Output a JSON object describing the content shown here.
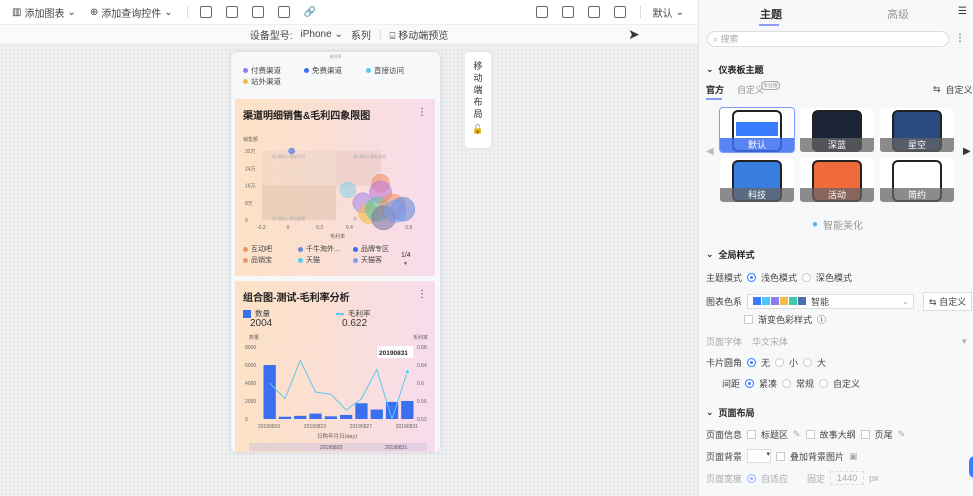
{
  "toolbar": {
    "add_chart": "添加图表",
    "add_query": "添加查询控件",
    "default": "默认"
  },
  "subbar": {
    "device_label": "设备型号:",
    "device": "iPhone",
    "series": "系列",
    "mobile_preview": "移动端预览"
  },
  "phone": {
    "top_caption": "毛利率",
    "legend_top": [
      {
        "label": "付费渠道",
        "color": "#8b7cf0"
      },
      {
        "label": "免费渠道",
        "color": "#3a6ff0"
      },
      {
        "label": "直接访问",
        "color": "#5bc8e8"
      },
      {
        "label": "站外渠道",
        "color": "#f5b94a"
      }
    ]
  },
  "side_layout": {
    "label": [
      "移",
      "动",
      "端",
      "布",
      "局"
    ]
  },
  "chart_data": [
    {
      "type": "scatter",
      "title": "渠道明细销售&毛利四象限图",
      "ylabel": "销售额",
      "xlabel": "毛利率",
      "yticks": [
        "32万",
        "24万",
        "16万",
        "8万",
        "0"
      ],
      "xticks": [
        "-0.2",
        "0",
        "0.2",
        "0.4",
        "0.8"
      ],
      "quadrants": [
        "低X指标Y指标写为",
        "高X指标Y指标变低",
        "低X指标Y指标变高",
        "高"
      ],
      "legend": [
        {
          "label": "互动吧",
          "color": "#f0956a"
        },
        {
          "label": "千牛淘外...",
          "color": "#6a8ad8"
        },
        {
          "label": "品牌专区",
          "color": "#3a6ff0"
        },
        {
          "label": "品销宝",
          "color": "#f0956a"
        },
        {
          "label": "天猫",
          "color": "#5bc8f0"
        },
        {
          "label": "天猫客",
          "color": "#7aa0f0"
        }
      ],
      "page": "1/4",
      "points": [
        {
          "x": 0,
          "y": 32,
          "r": 3,
          "c": "#3a6ff0"
        },
        {
          "x": 0.38,
          "y": 14,
          "r": 8,
          "c": "#8fd0ea"
        },
        {
          "x": 0.6,
          "y": 17,
          "r": 9,
          "c": "#f0956a"
        },
        {
          "x": 0.6,
          "y": 13,
          "r": 11,
          "c": "#c07ad8"
        },
        {
          "x": 0.48,
          "y": 8,
          "r": 10,
          "c": "#a98ce8"
        },
        {
          "x": 0.52,
          "y": 3,
          "r": 10,
          "c": "#f5b94a"
        },
        {
          "x": 0.58,
          "y": 5,
          "r": 12,
          "c": "#5bc8a0"
        },
        {
          "x": 0.68,
          "y": 6,
          "r": 13,
          "c": "#f0956a"
        },
        {
          "x": 0.75,
          "y": 5,
          "r": 12,
          "c": "#6a8ad8"
        },
        {
          "x": 0.62,
          "y": 1,
          "r": 12,
          "c": "#7a7aa8"
        },
        {
          "x": 0.7,
          "y": 4,
          "r": 11,
          "c": "#7aa0f0"
        }
      ]
    },
    {
      "type": "bar+line",
      "title": "组合图-测试-毛利率分析",
      "kpis": [
        {
          "label": "数量",
          "value": "2004",
          "color": "#3a6ff0"
        },
        {
          "label": "毛利率",
          "value": "0.622",
          "color": "#5bc8f0"
        }
      ],
      "ylabel": "数量",
      "y2label": "毛利率",
      "xlabel": "日购年月日(day)",
      "ylim": [
        0,
        8000
      ],
      "y2lim": [
        0.52,
        0.68
      ],
      "yticks": [
        "8000",
        "6000",
        "4000",
        "2000",
        "0"
      ],
      "y2ticks": [
        "0.68",
        "0.64",
        "0.6",
        "0.56",
        "0.52"
      ],
      "xticks": [
        "20190820",
        "20190823",
        "20190827",
        "20190831"
      ],
      "bars": [
        6000,
        250,
        350,
        600,
        300,
        450,
        1750,
        1050,
        1900,
        2000
      ],
      "line": [
        0.6,
        0.565,
        0.65,
        0.58,
        0.575,
        0.54,
        0.565,
        0.63,
        0.52,
        0.625
      ],
      "tooltip": "20190831",
      "slider": [
        "20190820",
        "20190831"
      ]
    }
  ],
  "panel": {
    "tabs": [
      "主题",
      "高级"
    ],
    "search_placeholder": "搜索",
    "section_theme": "仪表板主题",
    "subtabs": [
      "官方",
      "自定义"
    ],
    "pro_badge": "专业版",
    "custom": "自定义",
    "themes": [
      "默认",
      "深蓝",
      "星空",
      "科技",
      "活动",
      "简约"
    ],
    "beautify": "智能美化",
    "section_global": "全局样式",
    "theme_mode": "主题模式",
    "light": "浅色模式",
    "dark": "深色模式",
    "chart_colors": "图表色系",
    "palette": [
      "#3a7cff",
      "#4fc3f7",
      "#8b7cf0",
      "#f5b94a",
      "#41c9a8",
      "#4a6fb0"
    ],
    "palette_name": "智能",
    "gradient": "渐变色彩样式",
    "font_label": "页面字体",
    "font_value": "华文宋体",
    "radius": "卡片圆角",
    "radius_opts": [
      "无",
      "小",
      "大"
    ],
    "spacing": "间距",
    "spacing_opts": [
      "紧凑",
      "常规",
      "自定义"
    ],
    "section_layout": "页面布局",
    "page_info": "页面信息",
    "title_area": "标题区",
    "outline": "故事大纲",
    "footer": "页尾",
    "bg": "页面背景",
    "bg_image": "叠加背景图片",
    "width": "页面宽度",
    "adaptive": "自适应",
    "fixed": "固定",
    "width_value": "1440",
    "px": "px"
  }
}
